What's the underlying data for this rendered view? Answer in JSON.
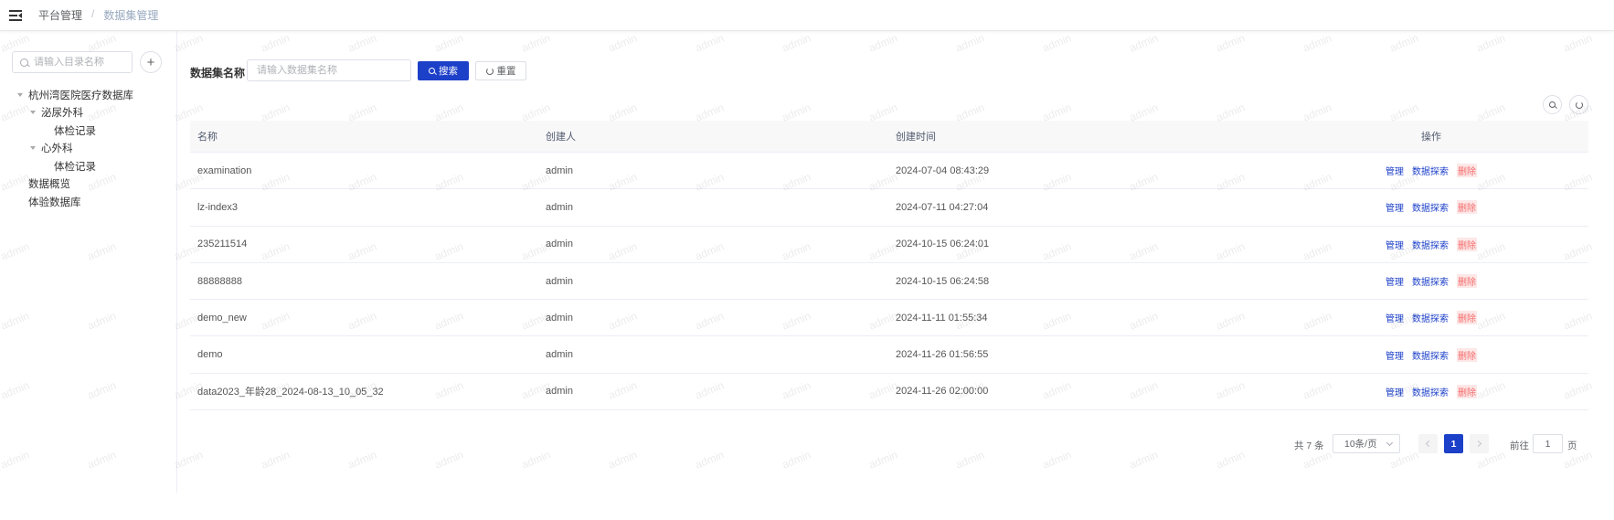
{
  "header": {
    "breadcrumb": [
      "平台管理",
      "数据集管理"
    ],
    "separator": "/"
  },
  "sidebar": {
    "search_placeholder": "请输入目录名称",
    "add_label": "+",
    "tree": [
      {
        "label": "杭州湾医院医疗数据库",
        "level": 0,
        "expanded": true
      },
      {
        "label": "泌尿外科",
        "level": 1,
        "expanded": true
      },
      {
        "label": "体检记录",
        "level": 2
      },
      {
        "label": "心外科",
        "level": 1,
        "expanded": true
      },
      {
        "label": "体检记录",
        "level": 2
      },
      {
        "label": "数据概览",
        "level": 0
      },
      {
        "label": "体验数据库",
        "level": 0
      }
    ]
  },
  "filter": {
    "label": "数据集名称",
    "placeholder": "请输入数据集名称",
    "search_label": "搜索",
    "reset_label": "重置"
  },
  "table": {
    "headers": [
      "名称",
      "创建人",
      "创建时间",
      "操作"
    ],
    "rows": [
      {
        "name": "examination",
        "creator": "admin",
        "created": "2024-07-04 08:43:29"
      },
      {
        "name": "lz-index3",
        "creator": "admin",
        "created": "2024-07-11 04:27:04"
      },
      {
        "name": "235211514",
        "creator": "admin",
        "created": "2024-10-15 06:24:01"
      },
      {
        "name": "88888888",
        "creator": "admin",
        "created": "2024-10-15 06:24:58"
      },
      {
        "name": "demo_new",
        "creator": "admin",
        "created": "2024-11-11 01:55:34"
      },
      {
        "name": "demo",
        "creator": "admin",
        "created": "2024-11-26 01:56:55"
      },
      {
        "name": "data2023_年龄28_2024-08-13_10_05_32",
        "creator": "admin",
        "created": "2024-11-26 02:00:00"
      }
    ],
    "actions": {
      "manage": "管理",
      "explore": "数据探索",
      "delete": "删除"
    }
  },
  "pagination": {
    "total": "共 7 条",
    "page_size": "10条/页",
    "current_page": "1",
    "goto_label": "前往",
    "goto_value": "1",
    "page_suffix": "页"
  },
  "watermark": {
    "text": "admin"
  },
  "colors": {
    "primary": "#1d40c9",
    "danger": "#f56c6c"
  }
}
